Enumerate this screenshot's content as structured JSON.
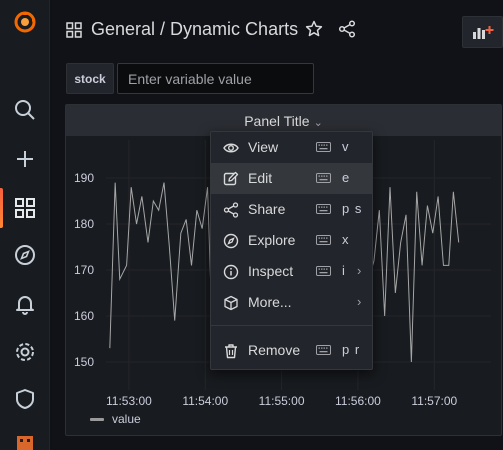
{
  "sidebar": {
    "items": [
      {
        "name": "grafana-logo-icon"
      },
      {
        "name": "search-icon"
      },
      {
        "name": "plus-icon"
      },
      {
        "name": "dashboards-icon",
        "active": true
      },
      {
        "name": "explore-compass-icon"
      },
      {
        "name": "bell-icon"
      },
      {
        "name": "gear-icon"
      },
      {
        "name": "shield-icon"
      },
      {
        "name": "user-avatar-icon"
      }
    ]
  },
  "header": {
    "breadcrumb": "General  / Dynamic Charts"
  },
  "variables": {
    "label": "stock",
    "placeholder": "Enter variable value",
    "value": ""
  },
  "panel": {
    "title": "Panel Title"
  },
  "menu": {
    "items": [
      {
        "label": "View",
        "icon": "eye-icon",
        "key": "v"
      },
      {
        "label": "Edit",
        "icon": "edit-icon",
        "key": "e",
        "active": true
      },
      {
        "label": "Share",
        "icon": "share-icon",
        "key": "p s"
      },
      {
        "label": "Explore",
        "icon": "compass-icon",
        "key": "x"
      },
      {
        "label": "Inspect",
        "icon": "info-icon",
        "key": "i",
        "submenu": true
      },
      {
        "label": "More...",
        "icon": "cube-icon",
        "key": "",
        "submenu": true
      },
      {
        "label": "Remove",
        "icon": "trash-icon",
        "key": "p r"
      }
    ]
  },
  "colors": {
    "series": "#a6a6a6",
    "accent": "#f55f3e",
    "link": "#6e9fff"
  },
  "chart_data": {
    "type": "line",
    "title": "Panel Title",
    "ylim": [
      145,
      195
    ],
    "yticks": [
      150,
      160,
      170,
      180,
      190
    ],
    "xticks": [
      "11:53:00",
      "11:54:00",
      "11:55:00",
      "11:56:00",
      "11:57:00"
    ],
    "xlim_minutes": [
      52.7,
      57.35
    ],
    "series": [
      {
        "name": "value",
        "x": [
          52.75,
          52.82,
          52.88,
          52.97,
          53.03,
          53.1,
          53.17,
          53.25,
          53.32,
          53.39,
          53.46,
          53.53,
          53.6,
          53.68,
          53.75,
          53.82,
          53.89,
          53.96,
          54.03,
          54.1,
          55.65,
          55.72,
          55.79,
          55.86,
          55.93,
          56.0,
          56.07,
          56.14,
          56.21,
          56.28,
          56.35,
          56.42,
          56.49,
          56.56,
          56.63,
          56.7,
          56.77,
          56.84,
          56.91,
          56.98,
          57.05,
          57.12,
          57.19,
          57.25,
          57.32
        ],
        "values": [
          153,
          189,
          168,
          171,
          188,
          180,
          186,
          176,
          185,
          183,
          189,
          175,
          159,
          178,
          181,
          171,
          183,
          179,
          188,
          152,
          178,
          170,
          182,
          173,
          186,
          172,
          179,
          168,
          172,
          183,
          160,
          188,
          165,
          176,
          182,
          150,
          187,
          171,
          184,
          178,
          186,
          171,
          171,
          187,
          176
        ]
      }
    ]
  }
}
